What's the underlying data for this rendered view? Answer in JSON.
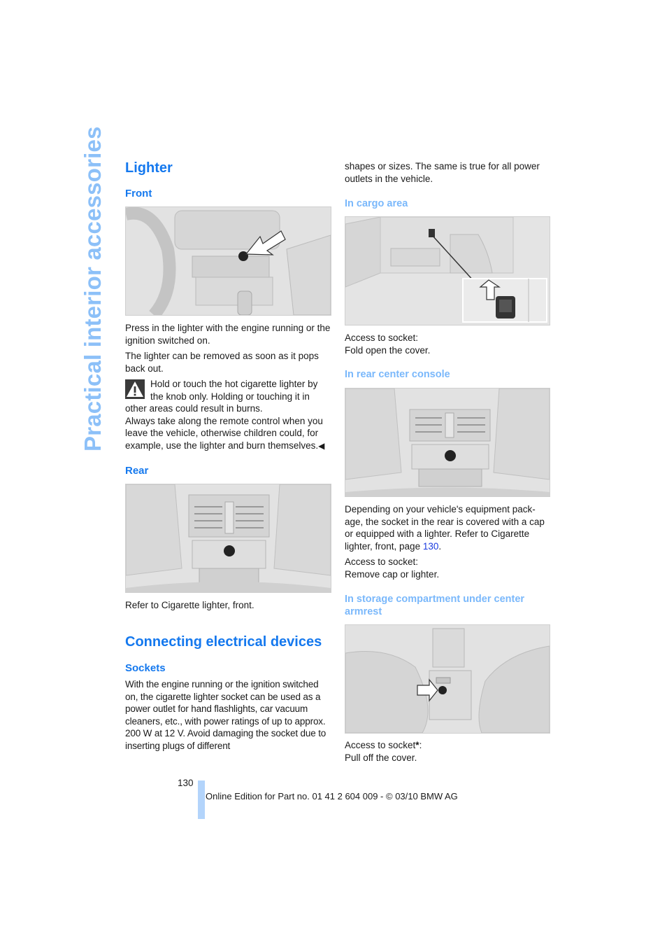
{
  "side_title": "Practical interior accessories",
  "left": {
    "lighter_heading": "Lighter",
    "front_heading": "Front",
    "front_figure_alt": "Center console with cigarette lighter, arrow pointing at lighter",
    "front_p1": "Press in the lighter with the engine running or the ignition switched on.",
    "front_p2": "The lighter can be removed as soon as it pops back out.",
    "warning_icon": "warning-triangle-icon",
    "warning_text_1": "Hold or touch the hot cigarette lighter by the knob only. Holding or touching it in other areas could result in burns.",
    "warning_text_2": "Always take along the remote control when you leave the vehicle, otherwise children could, for example, use the lighter and burn themselves.",
    "end_mark": "◀",
    "rear_heading": "Rear",
    "rear_figure_alt": "Rear center console with lighter below air vents",
    "rear_p1": "Refer to Cigarette lighter, front.",
    "connecting_heading": "Connecting electrical devices",
    "sockets_heading": "Sockets",
    "sockets_p1": "With the engine running or the ignition switched on, the cigarette lighter socket can be used as a power outlet for hand flashlights, car vacuum cleaners, etc., with power ratings of up to approx. 200 W at 12 V. Avoid damaging the socket due to inserting plugs of different"
  },
  "right": {
    "continued_text": "shapes or sizes. The same is true for all power outlets in the vehicle.",
    "cargo_heading": "In cargo area",
    "cargo_figure_alt": "Cargo area side panel with socket and detail inset",
    "cargo_access_label": "Access to socket:",
    "cargo_access_action": "Fold open the cover.",
    "rear_console_heading": "In rear center console",
    "rear_console_figure_alt": "Rear center console socket below air vents",
    "rear_console_p1_pre": "Depending on your vehicle's equipment pack-age, the socket in the rear is covered with a cap or equipped with a lighter. Refer to Cigarette lighter, front, page ",
    "rear_console_page_link": "130",
    "rear_console_p1_post": ".",
    "rear_console_access_label": "Access to socket:",
    "rear_console_access_action": "Remove cap or lighter.",
    "armrest_heading": "In storage compartment under center armrest",
    "armrest_figure_alt": "Storage compartment under center armrest with socket and arrow",
    "armrest_access_label": "Access to socket",
    "armrest_asterisk": "*",
    "armrest_colon": ":",
    "armrest_access_action": "Pull off the cover."
  },
  "footer": {
    "page_number": "130",
    "edition_text": "Online Edition for Part no. 01 41 2 604 009 - © 03/10 BMW AG"
  },
  "colors": {
    "heading_blue": "#1478ee",
    "subheading_light_blue": "#7ab8fb",
    "side_title": "#8cc0f8",
    "footer_bar": "#b3d4fb",
    "link": "#1a3adf"
  }
}
